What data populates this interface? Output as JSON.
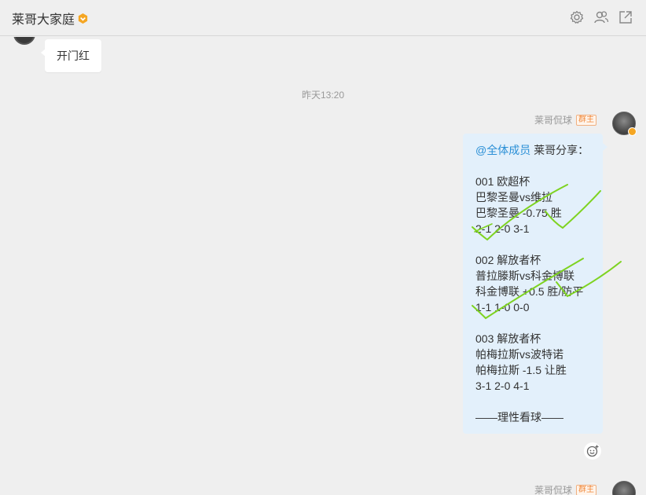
{
  "header": {
    "group_name": "莱哥大家庭",
    "icons": [
      "settings-icon",
      "members-icon",
      "popout-icon"
    ]
  },
  "messages": {
    "prev_left": {
      "text": "开门红"
    },
    "timestamp": "昨天13:20",
    "sender": {
      "name": "莱哥侃球",
      "role": "群主"
    },
    "post": {
      "mention": "@全体成员",
      "lines": [
        " 莱哥分享：",
        "",
        "001 欧超杯",
        "巴黎圣曼vs维拉",
        "巴黎圣曼 -0.75 胜",
        "2-1 2-0 3-1",
        "",
        "002 解放者杯",
        "普拉滕斯vs科金博联",
        "科金博联 +0.5 胜/防平",
        "1-1 1-0 0-0",
        "",
        "003 解放者杯",
        "帕梅拉斯vs波特诺",
        "帕梅拉斯 -1.5 让胜",
        "3-1 2-0 4-1",
        "",
        "——理性看球——"
      ]
    },
    "next_sender": {
      "name": "莱哥侃球",
      "role": "群主"
    }
  },
  "colors": {
    "mention": "#2a8fd6",
    "bubble_right": "#e3f0fb",
    "checkmark": "#7ed321",
    "owner_badge": "#f0883a"
  }
}
